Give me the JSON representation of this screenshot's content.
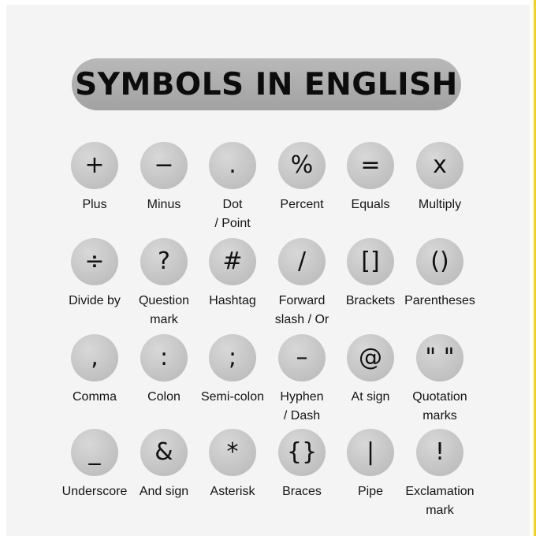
{
  "title": "SYMBOLS IN ENGLISH",
  "colors": {
    "card": "#f4f4f4",
    "pill": "#aaaaaa",
    "circle": "#c6c6c6",
    "accent_edge": "#f2d21a"
  },
  "rows": [
    [
      {
        "symbol": "+",
        "label": "Plus"
      },
      {
        "symbol": "−",
        "label": "Minus"
      },
      {
        "symbol": ".",
        "label": "Dot\n/ Point"
      },
      {
        "symbol": "%",
        "label": "Percent"
      },
      {
        "symbol": "=",
        "label": "Equals"
      },
      {
        "symbol": "x",
        "label": "Multiply"
      }
    ],
    [
      {
        "symbol": "÷",
        "label": "Divide by"
      },
      {
        "symbol": "?",
        "label": "Question\nmark"
      },
      {
        "symbol": "#",
        "label": "Hashtag"
      },
      {
        "symbol": "/",
        "label": "Forward\nslash / Or"
      },
      {
        "symbol": "[]",
        "label": "Brackets"
      },
      {
        "symbol": "()",
        "label": "Parentheses"
      }
    ],
    [
      {
        "symbol": ",",
        "label": "Comma"
      },
      {
        "symbol": ":",
        "label": "Colon"
      },
      {
        "symbol": ";",
        "label": "Semi-colon"
      },
      {
        "symbol": "–",
        "label": "Hyphen\n/ Dash"
      },
      {
        "symbol": "@",
        "label": "At sign"
      },
      {
        "symbol": "\" \"",
        "label": "Quotation\nmarks"
      }
    ],
    [
      {
        "symbol": "_",
        "label": "Underscore"
      },
      {
        "symbol": "&",
        "label": "And sign"
      },
      {
        "symbol": "*",
        "label": "Asterisk"
      },
      {
        "symbol": "{}",
        "label": "Braces"
      },
      {
        "symbol": "|",
        "label": "Pipe"
      },
      {
        "symbol": "!",
        "label": "Exclamation\nmark"
      }
    ]
  ]
}
